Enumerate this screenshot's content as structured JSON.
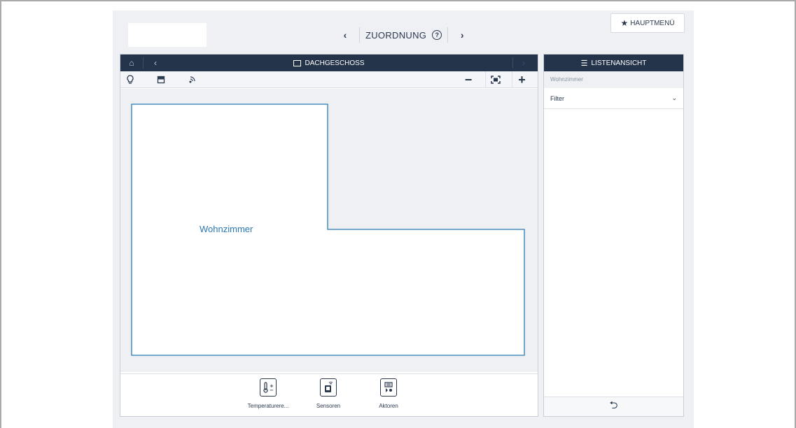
{
  "top_bar": {
    "title": "ZUORDNUNG",
    "prev_icon": "chevron-left",
    "next_icon": "chevron-right",
    "help_icon": "?",
    "main_menu_label": "HAUPTMENÜ",
    "main_menu_icon": "★"
  },
  "plan": {
    "floor_title": "DACHGESCHOSS",
    "header_icons": {
      "home": "⌂",
      "back": "‹",
      "forward": "›"
    },
    "toolbar_icons": {
      "zoom_out": "−",
      "zoom_fit": "▣",
      "zoom_in": "+"
    },
    "room_name": "Wohnzimmer",
    "tiles": [
      {
        "label": "Temperaturere...",
        "icon": "thermostat"
      },
      {
        "label": "Sensoren",
        "icon": "sensor"
      },
      {
        "label": "Aktoren",
        "icon": "actuator"
      }
    ]
  },
  "list": {
    "title": "LISTENANSICHT",
    "subtitle": "Wohnzimmer",
    "filter_label": "Filter",
    "back_icon": "⮌"
  },
  "colors": {
    "header_bg": "#24344b",
    "room_outline": "#2a79b5",
    "canvas_bg": "#eef0f4"
  }
}
